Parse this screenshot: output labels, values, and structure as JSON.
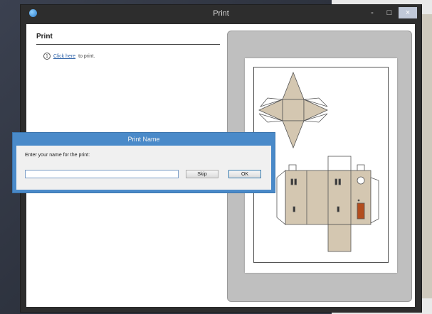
{
  "window": {
    "title": "Print",
    "controls": {
      "minimize": "-",
      "maximize": "□",
      "close": "×"
    }
  },
  "panel": {
    "title": "Print",
    "step": {
      "number": "1",
      "link_text": "Click here",
      "suffix": " to print."
    }
  },
  "dialog": {
    "title": "Print Name",
    "prompt": "Enter your name for the print:",
    "input_value": "",
    "skip_label": "Skip",
    "ok_label": "OK"
  },
  "colors": {
    "dialog_frame": "#4a8ac9",
    "window_chrome": "#2d2d2d",
    "preview_bg": "#bfbfbf",
    "papercraft_wall": "#d4c7b1",
    "door": "#b24d1e"
  },
  "icons": [
    "app-icon",
    "minimize-icon",
    "maximize-icon",
    "close-icon",
    "step-number-icon"
  ]
}
